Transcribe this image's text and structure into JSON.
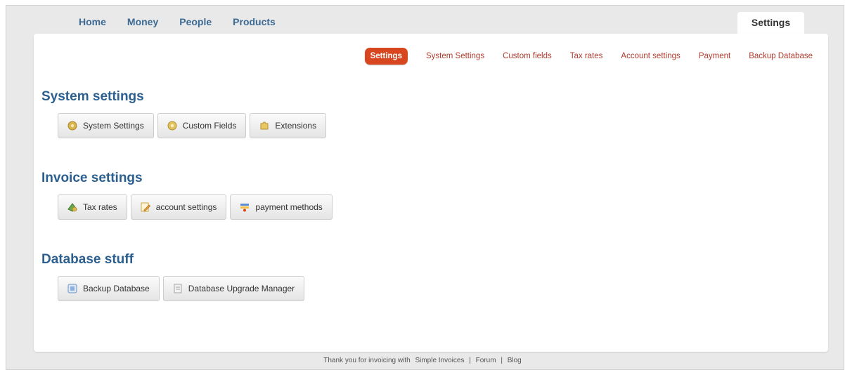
{
  "main_tabs": [
    {
      "label": "Home"
    },
    {
      "label": "Money"
    },
    {
      "label": "People"
    },
    {
      "label": "Products"
    }
  ],
  "active_tab": {
    "label": "Settings"
  },
  "subnav": {
    "active": "Settings",
    "items": [
      "System Settings",
      "Custom fields",
      "Tax rates",
      "Account settings",
      "Payment",
      "Backup Database"
    ]
  },
  "sections": {
    "system": {
      "title": "System settings",
      "buttons": [
        {
          "label": "System Settings",
          "icon": "gear-icon"
        },
        {
          "label": "Custom Fields",
          "icon": "gear-icon"
        },
        {
          "label": "Extensions",
          "icon": "puzzle-icon"
        }
      ]
    },
    "invoice": {
      "title": "Invoice settings",
      "buttons": [
        {
          "label": "Tax rates",
          "icon": "money-icon"
        },
        {
          "label": "account settings",
          "icon": "pencil-icon"
        },
        {
          "label": "payment methods",
          "icon": "payment-icon"
        }
      ]
    },
    "database": {
      "title": "Database stuff",
      "buttons": [
        {
          "label": "Backup Database",
          "icon": "database-icon"
        },
        {
          "label": "Database Upgrade Manager",
          "icon": "document-icon"
        }
      ]
    }
  },
  "footer": {
    "text": "Thank you for invoicing with",
    "brand": "Simple Invoices",
    "sep": "|",
    "forum": "Forum",
    "blog": "Blog"
  },
  "colors": {
    "accent": "#d8461f",
    "heading": "#2b5f8f",
    "tab_text": "#3d6a93",
    "subnav_link": "#b23a2e"
  }
}
